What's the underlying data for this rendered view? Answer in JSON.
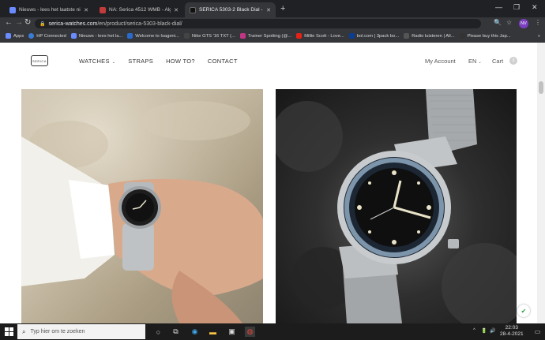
{
  "browser": {
    "tabs": [
      {
        "label": "Nieuws - lees het laatste nieuws",
        "favicon_color": "#6b8cff",
        "active": false
      },
      {
        "label": "NA: Serica 4512 WMB - Algemeen",
        "favicon_color": "#c23b3b",
        "active": false
      },
      {
        "label": "SERICA 5303-2 Black Dial - Swiss",
        "favicon_color": "#111111",
        "active": true
      }
    ],
    "new_tab": "+",
    "window_controls": [
      "—",
      "❐",
      "✕"
    ],
    "nav": {
      "back": "←",
      "forward": "→",
      "reload": "↻"
    },
    "address": {
      "host": "serica-watches.com",
      "path": "/en/product/serica-5303-black-dial/"
    },
    "toolbar_icons": [
      "🔍",
      "☆"
    ],
    "profile_initials": "NV",
    "menu": "⋮",
    "bookmarks": [
      {
        "label": "Apps",
        "color": "#6b8cff"
      },
      {
        "label": "HP Connected",
        "color": "#3a7bd5"
      },
      {
        "label": "Nieuws - lees het la...",
        "color": "#6b8cff"
      },
      {
        "label": "Welcome to Isageni...",
        "color": "#2a6acb"
      },
      {
        "label": "Nike GTS '16 TXT (...",
        "color": "#444444"
      },
      {
        "label": "Trainer Spotting (@...",
        "color": "#c13584"
      },
      {
        "label": "Millie Scott - Love...",
        "color": "#e62117"
      },
      {
        "label": "bol.com | 3pack bo...",
        "color": "#0a3d91"
      },
      {
        "label": "Radio luisteren | All...",
        "color": "#555555"
      },
      {
        "label": "Please buy this Jap...",
        "color": "#333333"
      }
    ],
    "more_bookmarks": "»"
  },
  "site": {
    "logo": "SERICA",
    "nav": [
      {
        "label": "WATCHES",
        "has_dropdown": true
      },
      {
        "label": "STRAPS",
        "has_dropdown": false
      },
      {
        "label": "HOW TO?",
        "has_dropdown": false
      },
      {
        "label": "CONTACT",
        "has_dropdown": false
      }
    ],
    "account": "My Account",
    "language": "EN",
    "cart": "Cart",
    "cart_count": "0",
    "images": [
      {
        "alt": "Watch worn on wrist over a map"
      },
      {
        "alt": "Serica 5303 black dial watch close-up"
      }
    ]
  },
  "taskbar": {
    "search_placeholder": "Typ hier om te zoeken",
    "time": "22:03",
    "date": "28-4-2021",
    "tray_icons": [
      "^",
      "🔋",
      "🔊"
    ]
  },
  "colors": {
    "chrome_dark": "#202124",
    "chrome_mid": "#35363a",
    "taskbar": "#1c1c1c",
    "accent_profile": "#7b3fbf"
  }
}
